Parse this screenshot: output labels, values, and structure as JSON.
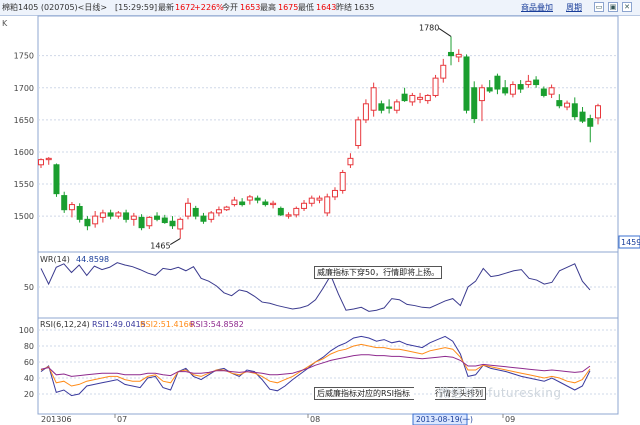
{
  "header": {
    "code": "棉粕1405 (020705)<日线>",
    "time": "[15:29:59]",
    "latest_label": "最新",
    "latest_value": "1672",
    "change": "+2",
    "change_pct": "26%",
    "open_label": "今开",
    "open_value": "1653",
    "high_label": "最高",
    "high_value": "1675",
    "low_label": "最低",
    "low_value": "1643",
    "prev_label": "昨结",
    "prev_value": "1635",
    "btn_overlay": "商品叠加",
    "btn_period": "周期",
    "win_controls": [
      "▭",
      "▣",
      "✕"
    ]
  },
  "colors": {
    "up": "#e8383d",
    "down": "#1a9e2f",
    "grid": "#cfd8e8",
    "rsi1": "#3a3a9e",
    "rsi2": "#ff8c1a",
    "rsi3": "#8e2a8e",
    "wr": "#3a3a8e"
  },
  "chart_data": [
    {
      "type": "candlestick",
      "title": "K",
      "yticks": [
        1500,
        1550,
        1600,
        1650,
        1700,
        1750
      ],
      "ylim": [
        1455,
        1790
      ],
      "current_price_tag": "1459",
      "annotations": [
        {
          "text": "1780",
          "at": "high"
        },
        {
          "text": "1465",
          "at": "low"
        }
      ],
      "candles": [
        {
          "o": 1580,
          "h": 1590,
          "l": 1575,
          "c": 1588
        },
        {
          "o": 1588,
          "h": 1592,
          "l": 1580,
          "c": 1590
        },
        {
          "o": 1580,
          "h": 1582,
          "l": 1530,
          "c": 1535
        },
        {
          "o": 1532,
          "h": 1538,
          "l": 1505,
          "c": 1510
        },
        {
          "o": 1510,
          "h": 1522,
          "l": 1498,
          "c": 1518
        },
        {
          "o": 1515,
          "h": 1520,
          "l": 1490,
          "c": 1495
        },
        {
          "o": 1495,
          "h": 1500,
          "l": 1478,
          "c": 1485
        },
        {
          "o": 1488,
          "h": 1508,
          "l": 1482,
          "c": 1500
        },
        {
          "o": 1498,
          "h": 1510,
          "l": 1490,
          "c": 1505
        },
        {
          "o": 1505,
          "h": 1510,
          "l": 1495,
          "c": 1500
        },
        {
          "o": 1500,
          "h": 1508,
          "l": 1496,
          "c": 1505
        },
        {
          "o": 1505,
          "h": 1510,
          "l": 1490,
          "c": 1495
        },
        {
          "o": 1495,
          "h": 1505,
          "l": 1485,
          "c": 1500
        },
        {
          "o": 1498,
          "h": 1503,
          "l": 1478,
          "c": 1482
        },
        {
          "o": 1485,
          "h": 1500,
          "l": 1480,
          "c": 1498
        },
        {
          "o": 1500,
          "h": 1506,
          "l": 1492,
          "c": 1495
        },
        {
          "o": 1497,
          "h": 1502,
          "l": 1488,
          "c": 1490
        },
        {
          "o": 1492,
          "h": 1500,
          "l": 1480,
          "c": 1485
        },
        {
          "o": 1480,
          "h": 1498,
          "l": 1465,
          "c": 1495
        },
        {
          "o": 1500,
          "h": 1528,
          "l": 1495,
          "c": 1520
        },
        {
          "o": 1512,
          "h": 1516,
          "l": 1495,
          "c": 1500
        },
        {
          "o": 1500,
          "h": 1505,
          "l": 1488,
          "c": 1492
        },
        {
          "o": 1495,
          "h": 1508,
          "l": 1490,
          "c": 1505
        },
        {
          "o": 1505,
          "h": 1515,
          "l": 1500,
          "c": 1510
        },
        {
          "o": 1510,
          "h": 1516,
          "l": 1508,
          "c": 1514
        },
        {
          "o": 1518,
          "h": 1530,
          "l": 1515,
          "c": 1525
        },
        {
          "o": 1522,
          "h": 1528,
          "l": 1515,
          "c": 1518
        },
        {
          "o": 1525,
          "h": 1533,
          "l": 1518,
          "c": 1530
        },
        {
          "o": 1528,
          "h": 1532,
          "l": 1520,
          "c": 1525
        },
        {
          "o": 1522,
          "h": 1526,
          "l": 1515,
          "c": 1518
        },
        {
          "o": 1518,
          "h": 1524,
          "l": 1512,
          "c": 1520
        },
        {
          "o": 1512,
          "h": 1515,
          "l": 1500,
          "c": 1502
        },
        {
          "o": 1500,
          "h": 1506,
          "l": 1496,
          "c": 1502
        },
        {
          "o": 1502,
          "h": 1515,
          "l": 1498,
          "c": 1512
        },
        {
          "o": 1512,
          "h": 1525,
          "l": 1508,
          "c": 1520
        },
        {
          "o": 1520,
          "h": 1532,
          "l": 1515,
          "c": 1528
        },
        {
          "o": 1525,
          "h": 1532,
          "l": 1520,
          "c": 1528
        },
        {
          "o": 1505,
          "h": 1535,
          "l": 1500,
          "c": 1530
        },
        {
          "o": 1530,
          "h": 1545,
          "l": 1525,
          "c": 1540
        },
        {
          "o": 1540,
          "h": 1572,
          "l": 1535,
          "c": 1568
        },
        {
          "o": 1580,
          "h": 1598,
          "l": 1575,
          "c": 1590
        },
        {
          "o": 1610,
          "h": 1655,
          "l": 1605,
          "c": 1650
        },
        {
          "o": 1650,
          "h": 1682,
          "l": 1645,
          "c": 1675
        },
        {
          "o": 1665,
          "h": 1708,
          "l": 1655,
          "c": 1700
        },
        {
          "o": 1675,
          "h": 1680,
          "l": 1660,
          "c": 1665
        },
        {
          "o": 1670,
          "h": 1682,
          "l": 1660,
          "c": 1668
        },
        {
          "o": 1665,
          "h": 1682,
          "l": 1660,
          "c": 1678
        },
        {
          "o": 1690,
          "h": 1700,
          "l": 1678,
          "c": 1680
        },
        {
          "o": 1678,
          "h": 1692,
          "l": 1672,
          "c": 1688
        },
        {
          "o": 1682,
          "h": 1692,
          "l": 1676,
          "c": 1685
        },
        {
          "o": 1680,
          "h": 1690,
          "l": 1675,
          "c": 1688
        },
        {
          "o": 1688,
          "h": 1720,
          "l": 1685,
          "c": 1715
        },
        {
          "o": 1715,
          "h": 1745,
          "l": 1708,
          "c": 1735
        },
        {
          "o": 1755,
          "h": 1780,
          "l": 1735,
          "c": 1750
        },
        {
          "o": 1748,
          "h": 1760,
          "l": 1740,
          "c": 1752
        },
        {
          "o": 1748,
          "h": 1752,
          "l": 1660,
          "c": 1665
        },
        {
          "o": 1700,
          "h": 1710,
          "l": 1645,
          "c": 1652
        },
        {
          "o": 1680,
          "h": 1705,
          "l": 1648,
          "c": 1700
        },
        {
          "o": 1700,
          "h": 1712,
          "l": 1692,
          "c": 1695
        },
        {
          "o": 1718,
          "h": 1722,
          "l": 1690,
          "c": 1698
        },
        {
          "o": 1700,
          "h": 1712,
          "l": 1688,
          "c": 1692
        },
        {
          "o": 1690,
          "h": 1710,
          "l": 1685,
          "c": 1705
        },
        {
          "o": 1705,
          "h": 1712,
          "l": 1692,
          "c": 1698
        },
        {
          "o": 1705,
          "h": 1720,
          "l": 1700,
          "c": 1710
        },
        {
          "o": 1712,
          "h": 1718,
          "l": 1700,
          "c": 1705
        },
        {
          "o": 1698,
          "h": 1702,
          "l": 1685,
          "c": 1688
        },
        {
          "o": 1690,
          "h": 1705,
          "l": 1684,
          "c": 1700
        },
        {
          "o": 1680,
          "h": 1690,
          "l": 1668,
          "c": 1672
        },
        {
          "o": 1670,
          "h": 1680,
          "l": 1665,
          "c": 1676
        },
        {
          "o": 1675,
          "h": 1685,
          "l": 1650,
          "c": 1655
        },
        {
          "o": 1662,
          "h": 1670,
          "l": 1645,
          "c": 1648
        },
        {
          "o": 1652,
          "h": 1658,
          "l": 1615,
          "c": 1640
        },
        {
          "o": 1653,
          "h": 1675,
          "l": 1643,
          "c": 1672
        }
      ]
    },
    {
      "type": "line",
      "title_label": "WR(14)",
      "title_value": "44.8598",
      "ytick": "50",
      "ylim": [
        0,
        100
      ],
      "annotation": "威廉指标下穿50，行情即将上扬。",
      "series": [
        {
          "values": [
            82,
            55,
            84,
            90,
            75,
            88,
            70,
            86,
            80,
            84,
            92,
            88,
            85,
            80,
            74,
            70,
            82,
            80,
            84,
            78,
            85,
            65,
            60,
            52,
            40,
            35,
            45,
            42,
            34,
            24,
            22,
            18,
            15,
            12,
            14,
            18,
            28,
            48,
            70,
            38,
            10,
            12,
            15,
            8,
            10,
            14,
            30,
            28,
            20,
            18,
            15,
            14,
            20,
            26,
            30,
            18,
            50,
            60,
            82,
            68,
            70,
            74,
            78,
            80,
            65,
            62,
            55,
            58,
            78,
            84,
            90,
            60,
            44.86
          ]
        }
      ]
    },
    {
      "type": "line",
      "title_label": "RSI(6,12,24)",
      "ylim": [
        0,
        100
      ],
      "yticks": [
        20,
        40,
        60,
        80,
        100
      ],
      "xticks": [
        "201306",
        "07",
        "08",
        "09"
      ],
      "highlight_date": "2013-08-19(一)",
      "annotation": "后威廉指标对应的RSI指标",
      "annotation_tail": "行情多头排列",
      "watermark": "微信号：futuresking",
      "series": [
        {
          "name": "RSI1",
          "label": "RSI1:49.0415",
          "values": [
            48,
            55,
            22,
            25,
            18,
            20,
            30,
            32,
            34,
            36,
            38,
            32,
            30,
            28,
            40,
            42,
            28,
            25,
            48,
            52,
            42,
            38,
            44,
            50,
            52,
            46,
            42,
            50,
            48,
            38,
            26,
            24,
            30,
            38,
            45,
            52,
            60,
            66,
            74,
            80,
            84,
            90,
            92,
            90,
            86,
            88,
            84,
            86,
            82,
            80,
            78,
            84,
            88,
            92,
            86,
            70,
            42,
            44,
            56,
            52,
            50,
            48,
            45,
            42,
            40,
            38,
            36,
            40,
            35,
            30,
            25,
            30,
            49.04
          ]
        },
        {
          "name": "RSI2",
          "label": "RSI2:51.4166",
          "values": [
            50,
            54,
            34,
            36,
            30,
            32,
            36,
            38,
            40,
            42,
            42,
            38,
            36,
            36,
            42,
            44,
            36,
            34,
            48,
            50,
            44,
            42,
            46,
            50,
            50,
            46,
            44,
            48,
            46,
            42,
            36,
            34,
            38,
            42,
            48,
            54,
            60,
            64,
            70,
            74,
            76,
            80,
            82,
            80,
            78,
            78,
            76,
            76,
            74,
            72,
            70,
            74,
            76,
            78,
            76,
            66,
            50,
            50,
            56,
            54,
            52,
            50,
            48,
            46,
            44,
            42,
            40,
            42,
            40,
            36,
            34,
            38,
            51.42
          ]
        },
        {
          "name": "RSI3",
          "label": "RSI3:54.8582",
          "values": [
            51,
            53,
            44,
            45,
            42,
            43,
            44,
            45,
            46,
            46,
            46,
            44,
            44,
            44,
            46,
            46,
            44,
            43,
            48,
            48,
            46,
            46,
            47,
            49,
            49,
            48,
            47,
            48,
            47,
            46,
            44,
            44,
            45,
            46,
            49,
            52,
            56,
            59,
            62,
            64,
            66,
            68,
            69,
            69,
            68,
            68,
            67,
            67,
            66,
            65,
            64,
            65,
            66,
            67,
            66,
            62,
            55,
            55,
            57,
            56,
            55,
            54,
            53,
            52,
            51,
            50,
            49,
            50,
            49,
            48,
            47,
            48,
            54.86
          ]
        }
      ]
    }
  ]
}
